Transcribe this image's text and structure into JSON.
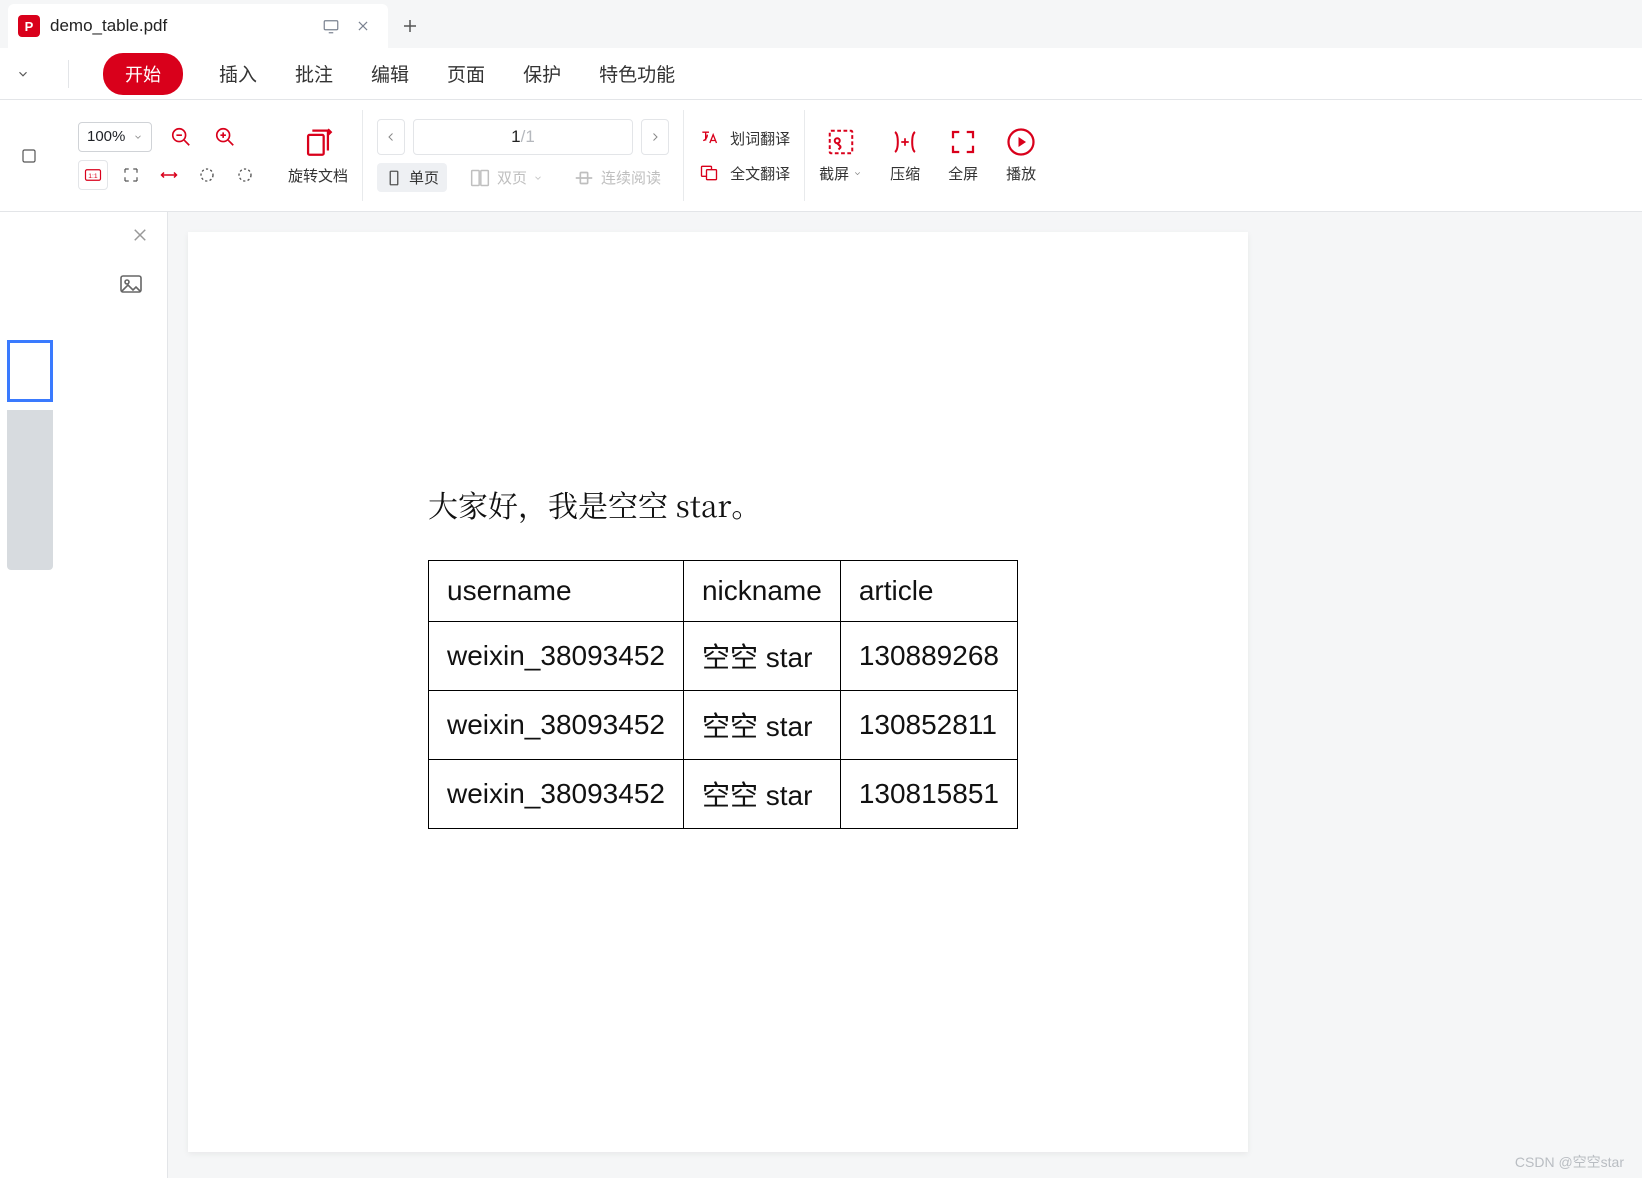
{
  "tab": {
    "title": "demo_table.pdf",
    "icon_text": "P"
  },
  "menu": {
    "dropdown": "▾",
    "items": [
      "开始",
      "插入",
      "批注",
      "编辑",
      "页面",
      "保护",
      "特色功能"
    ],
    "active_index": 0
  },
  "toolbar": {
    "zoom": "100%",
    "rotate": "旋转文档",
    "single_page": "单页",
    "double_page": "双页",
    "continuous": "连续阅读",
    "word_trans": "划词翻译",
    "full_trans": "全文翻译",
    "screenshot": "截屏",
    "compress": "压缩",
    "fullscreen": "全屏",
    "play": "播放",
    "page_current": "1",
    "page_sep": "/",
    "page_total": "1"
  },
  "document": {
    "heading": "大家好，我是空空 star。",
    "table": {
      "headers": [
        "username",
        "nickname",
        "article"
      ],
      "rows": [
        [
          "weixin_38093452",
          "空空 star",
          "130889268"
        ],
        [
          "weixin_38093452",
          "空空 star",
          "130852811"
        ],
        [
          "weixin_38093452",
          "空空 star",
          "130815851"
        ]
      ]
    }
  },
  "watermark": "CSDN @空空star"
}
